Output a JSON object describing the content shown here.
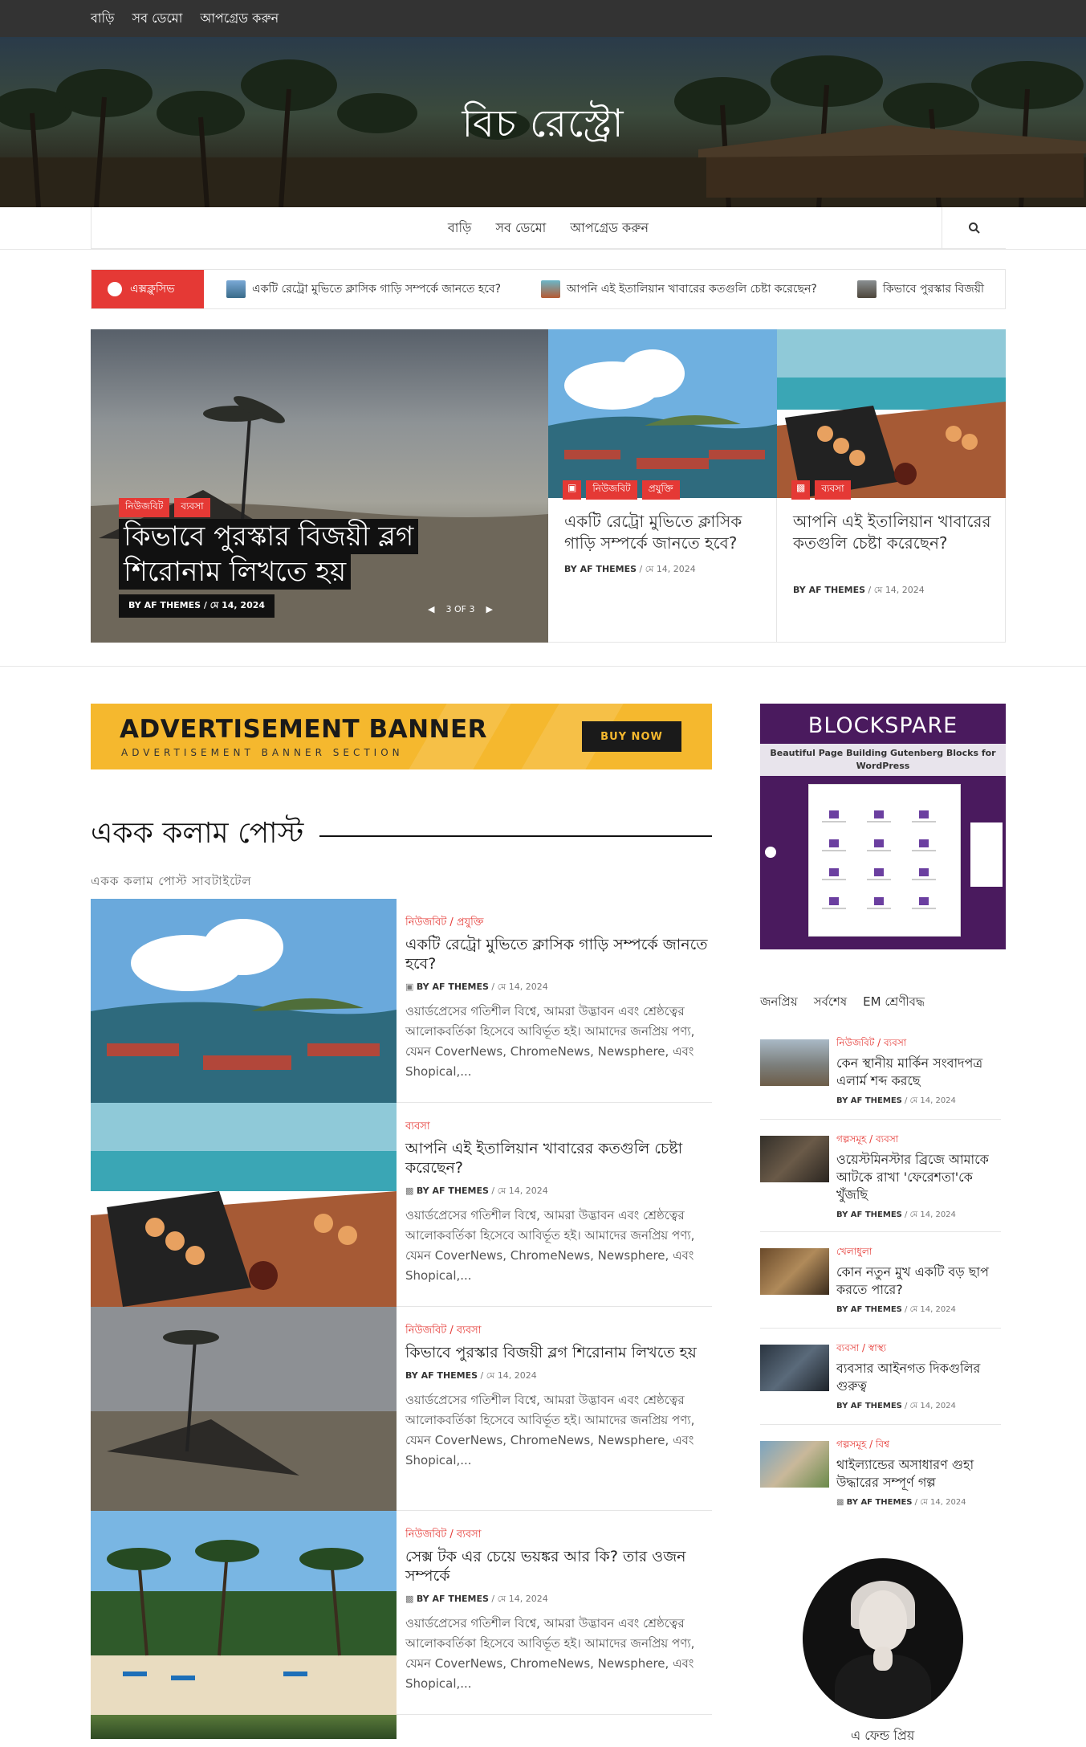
{
  "topbar": {
    "links": [
      "বাড়ি",
      "সব ডেমো",
      "আপগ্রেড করুন"
    ]
  },
  "site": {
    "title": "বিচ রেস্ট্রো"
  },
  "mainnav": {
    "links": [
      "বাড়ি",
      "সব ডেমো",
      "আপগ্রেড করুন"
    ]
  },
  "ticker": {
    "label": "এক্সক্লুসিভ",
    "items": [
      "একটি রেট্রো মুভিতে ক্লাসিক গাড়ি সম্পর্কে জানতে হবে?",
      "আপনি এই ইতালিয়ান খাবারের কতগুলি চেষ্টা করেছেন?",
      "কিভাবে পুরস্কার বিজয়ী"
    ]
  },
  "featured": {
    "cats": [
      "নিউজবিট",
      "ব্যবসা"
    ],
    "title": "কিভাবে পুরস্কার বিজয়ী ব্লগ শিরোনাম লিখতে হয়",
    "meta": "BY AF THEMES  /  মে 14, 2024",
    "pager": "3 OF 3"
  },
  "cards": [
    {
      "cats": [
        "নিউজবিট",
        "প্রযুক্তি"
      ],
      "title": "একটি রেট্রো মুভিতে ক্লাসিক গাড়ি সম্পর্কে জানতে হবে?",
      "by": "BY AF THEMES",
      "date": " / মে 14, 2024"
    },
    {
      "cats": [
        "ব্যবসা"
      ],
      "title": "আপনি এই ইতালিয়ান খাবারের কতগুলি চেষ্টা করেছেন?",
      "by": "BY AF THEMES",
      "date": " / মে 14, 2024"
    }
  ],
  "ad": {
    "title": "ADVERTISEMENT BANNER",
    "subtitle": "ADVERTISEMENT BANNER SECTION",
    "button": "BUY NOW"
  },
  "section": {
    "title": "একক কলাম পোস্ট",
    "subtitle": "একক কলাম পোস্ট সাবটাইটেল"
  },
  "posts": [
    {
      "cats": "নিউজবিট / প্রযুক্তি",
      "title": "একটি রেট্রো মুভিতে ক্লাসিক গাড়ি সম্পর্কে জানতে হবে?",
      "by": "BY AF THEMES",
      "date": " / মে 14, 2024",
      "excerpt": "ওয়ার্ডপ্রেসের গতিশীল বিশ্বে, আমরা উদ্ভাবন এবং শ্রেষ্ঠত্বের আলোকবর্তিকা হিসেবে আবির্ভূত হই। আমাদের জনপ্রিয় পণ্য, যেমন CoverNews, ChromeNews, Newsphere, এবং Shopical,..."
    },
    {
      "cats": "ব্যবসা",
      "title": "আপনি এই ইতালিয়ান খাবারের কতগুলি চেষ্টা করেছেন?",
      "by": "BY AF THEMES",
      "date": " / মে 14, 2024",
      "excerpt": "ওয়ার্ডপ্রেসের গতিশীল বিশ্বে, আমরা উদ্ভাবন এবং শ্রেষ্ঠত্বের আলোকবর্তিকা হিসেবে আবির্ভূত হই। আমাদের জনপ্রিয় পণ্য, যেমন CoverNews, ChromeNews, Newsphere, এবং Shopical,..."
    },
    {
      "cats": "নিউজবিট / ব্যবসা",
      "title": "কিভাবে পুরস্কার বিজয়ী ব্লগ শিরোনাম লিখতে হয়",
      "by": "BY AF THEMES",
      "date": " / মে 14, 2024",
      "excerpt": "ওয়ার্ডপ্রেসের গতিশীল বিশ্বে, আমরা উদ্ভাবন এবং শ্রেষ্ঠত্বের আলোকবর্তিকা হিসেবে আবির্ভূত হই। আমাদের জনপ্রিয় পণ্য, যেমন CoverNews, ChromeNews, Newsphere, এবং Shopical,..."
    },
    {
      "cats": "নিউজবিট / ব্যবসা",
      "title": "সেক্স টক এর চেয়ে ভয়ঙ্কর আর কি? তার ওজন সম্পর্কে",
      "by": "BY AF THEMES",
      "date": " / মে 14, 2024",
      "excerpt": "ওয়ার্ডপ্রেসের গতিশীল বিশ্বে, আমরা উদ্ভাবন এবং শ্রেষ্ঠত্বের আলোকবর্তিকা হিসেবে আবির্ভূত হই। আমাদের জনপ্রিয় পণ্য, যেমন CoverNews, ChromeNews, Newsphere, এবং Shopical,..."
    }
  ],
  "blockspare": {
    "title": "BLOCKSPARE",
    "tagline": "Beautiful Page Building Gutenberg Blocks for WordPress"
  },
  "sidebar": {
    "tabs": [
      "জনপ্রিয়",
      "সর্বশেষ",
      "EM শ্রেণীবদ্ধ"
    ],
    "items": [
      {
        "cats": "নিউজবিট / ব্যবসা",
        "title": "কেন স্থানীয় মার্কিন সংবাদপত্র এলার্ম শব্দ করছে",
        "by": "BY AF THEMES",
        "date": " / মে 14, 2024"
      },
      {
        "cats": "গল্পসমূহ / ব্যবসা",
        "title": "ওয়েস্টমিনস্টার ব্রিজে আমাকে আটকে রাখা 'ফেরেশতা'কে খুঁজছি",
        "by": "BY AF THEMES",
        "date": " / মে 14, 2024"
      },
      {
        "cats": "খেলাধুলা",
        "title": "কোন নতুন মুখ একটি বড় ছাপ করতে পারে?",
        "by": "BY AF THEMES",
        "date": " / মে 14, 2024"
      },
      {
        "cats": "ব্যবসা / স্বাস্থ্য",
        "title": "ব্যবসার আইনগত দিকগুলির গুরুত্ব",
        "by": "BY AF THEMES",
        "date": " / মে 14, 2024"
      },
      {
        "cats": "গল্পসমূহ / বিশ্ব",
        "title": "থাইল্যান্ডের অসাধারণ গুহা উদ্ধারের সম্পূর্ণ গল্প",
        "by": "BY AF THEMES",
        "date": " / মে 14, 2024"
      }
    ]
  },
  "profile": {
    "name": "এ ফেন্ড প্রিয়"
  },
  "colors": {
    "accent": "#e53935",
    "topbar": "#333333",
    "ad": "#f5b82e",
    "blockspare": "#4a1a5e"
  }
}
